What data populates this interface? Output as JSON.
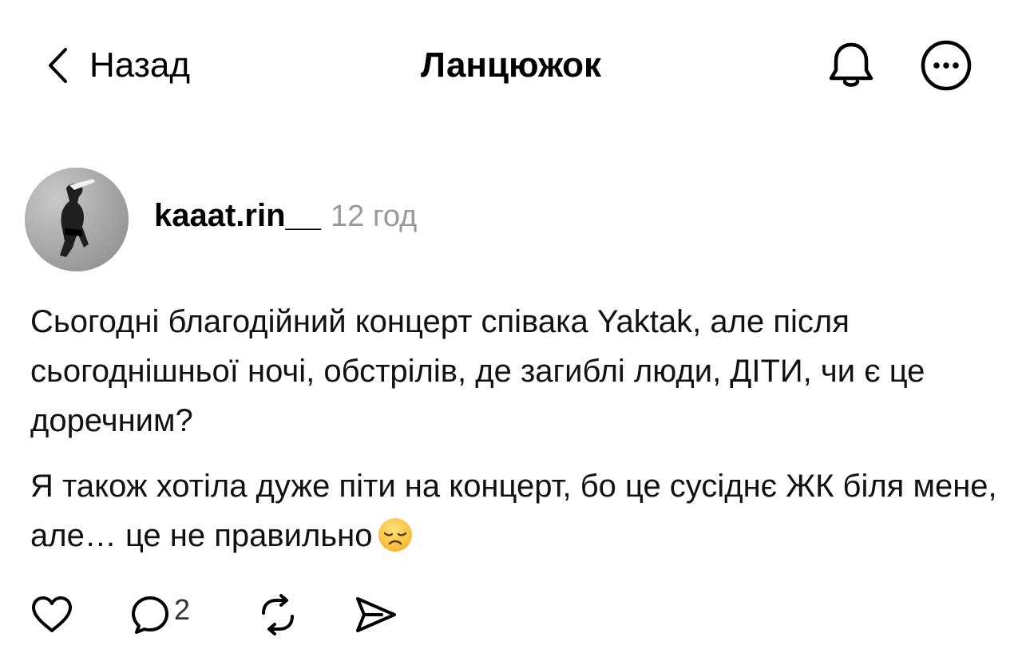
{
  "header": {
    "back_label": "Назад",
    "title": "Ланцюжок",
    "icons": {
      "back": "chevron-left-icon",
      "notifications": "bell-icon",
      "more": "more-circle-icon"
    }
  },
  "post": {
    "author": "kaaat.rin__",
    "timestamp": "12 год",
    "paragraphs": [
      "Сьогодні благодійний концерт співака Yaktak, але після сьогоднішньої ночі, обстрілів, де загиблі люди, ДІТИ, чи є це доречним?",
      "Я також хотіла дуже піти на концерт, бо це сусіднє ЖК біля мене, але… це не правильно"
    ],
    "emoji": "disappointed-face-emoji",
    "actions": {
      "like_icon": "heart-icon",
      "reply_icon": "comment-bubble-icon",
      "reply_count": "2",
      "repost_icon": "repost-icon",
      "share_icon": "send-icon"
    }
  },
  "colors": {
    "text": "#000000",
    "muted": "#9a9a9a",
    "emoji": "#f7c73e"
  }
}
